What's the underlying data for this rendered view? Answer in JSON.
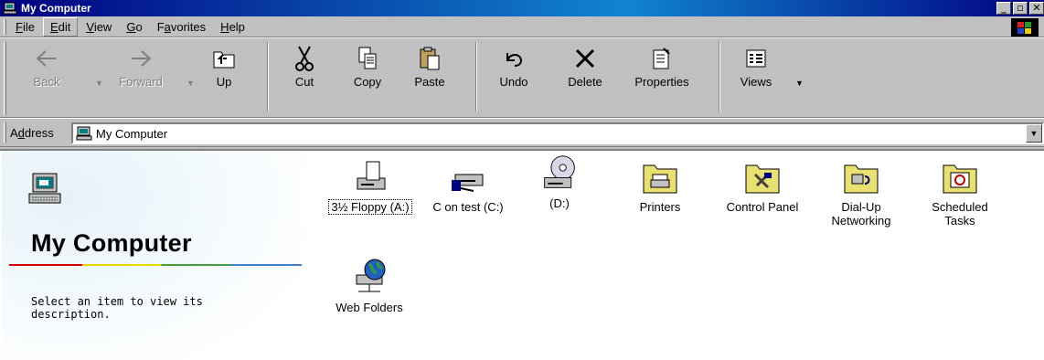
{
  "window": {
    "title": "My Computer",
    "controls": [
      "_",
      "▫",
      "×"
    ]
  },
  "menu": [
    {
      "label": "File",
      "accel": "F",
      "rest": "ile"
    },
    {
      "label": "Edit",
      "accel": "E",
      "rest": "dit"
    },
    {
      "label": "View",
      "accel": "V",
      "rest": "iew"
    },
    {
      "label": "Go",
      "accel": "G",
      "rest": "o"
    },
    {
      "label": "Favorites",
      "accel": "a",
      "pre": "F",
      "rest": "vorites"
    },
    {
      "label": "Help",
      "accel": "H",
      "rest": "elp"
    }
  ],
  "toolbar": {
    "back": "Back",
    "forward": "Forward",
    "up": "Up",
    "cut": "Cut",
    "copy": "Copy",
    "paste": "Paste",
    "undo": "Undo",
    "delete": "Delete",
    "properties": "Properties",
    "views": "Views"
  },
  "address": {
    "label_pre": "A",
    "label_accel": "d",
    "label_rest": "dress",
    "value": "My Computer"
  },
  "left_pane": {
    "title": "My Computer",
    "description": "Select an item to view its description."
  },
  "items": [
    {
      "label": "3½ Floppy (A:)",
      "icon": "floppy-drive-icon"
    },
    {
      "label": "C on test (C:)",
      "icon": "network-drive-icon"
    },
    {
      "label": "(D:)",
      "icon": "cd-drive-icon"
    },
    {
      "label": "Printers",
      "icon": "printers-folder-icon"
    },
    {
      "label": "Control Panel",
      "icon": "control-panel-folder-icon"
    },
    {
      "label": "Dial-Up Networking",
      "icon": "dialup-networking-folder-icon"
    },
    {
      "label": "Scheduled Tasks",
      "icon": "scheduled-tasks-folder-icon"
    },
    {
      "label": "Web Folders",
      "icon": "web-folders-icon"
    }
  ],
  "colors": {
    "titlebar": "#000080",
    "face": "#c0c0c0",
    "folder": "#e8e070"
  }
}
